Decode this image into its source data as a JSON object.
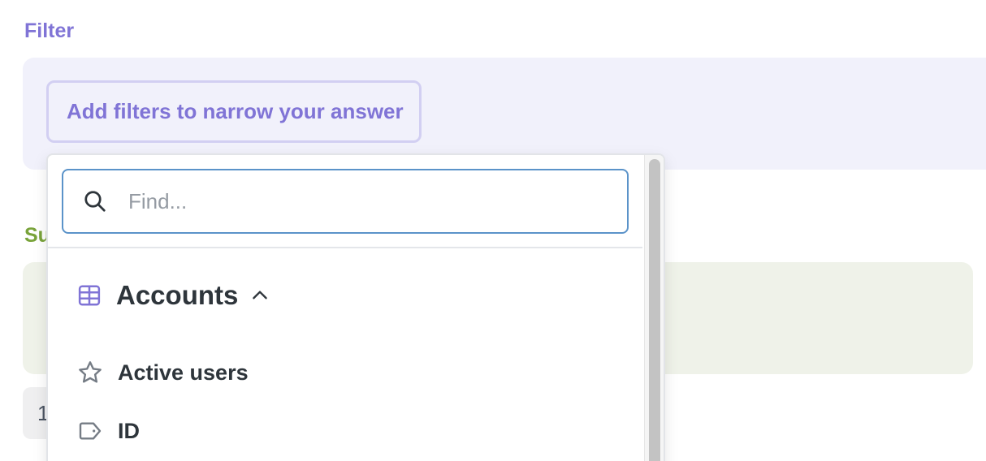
{
  "filter": {
    "label": "Filter",
    "add_button_label": "Add filters to narrow your answer"
  },
  "summarize": {
    "label_visible": "Su"
  },
  "limit": {
    "value_visible": "1"
  },
  "popover": {
    "search": {
      "placeholder": "Find...",
      "value": ""
    },
    "group": {
      "title": "Accounts",
      "icon": "table-icon",
      "expanded": true
    },
    "items": [
      {
        "label": "Active users",
        "icon": "star-icon"
      },
      {
        "label": "ID",
        "icon": "tag-icon"
      }
    ]
  },
  "colors": {
    "filter_accent": "#8074d6",
    "filter_bg": "#f1f1fb",
    "summarize_accent": "#79a33a",
    "summarize_bg": "#eff2e9",
    "search_border": "#5b93c9",
    "text_dark": "#2e353b"
  }
}
